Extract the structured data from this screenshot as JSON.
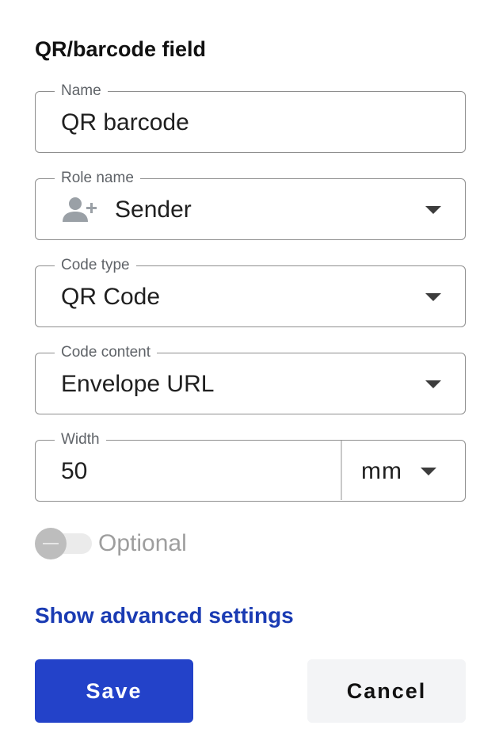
{
  "panel": {
    "title": "QR/barcode field"
  },
  "fields": {
    "name": {
      "label": "Name",
      "value": "QR barcode"
    },
    "role": {
      "label": "Role name",
      "value": "Sender",
      "icon": "add-person-icon"
    },
    "code_type": {
      "label": "Code type",
      "value": "QR Code"
    },
    "code_content": {
      "label": "Code content",
      "value": "Envelope URL"
    },
    "width": {
      "label": "Width",
      "value": "50",
      "unit": "mm"
    }
  },
  "optional_toggle": {
    "label": "Optional",
    "on": false
  },
  "advanced_link": "Show advanced settings",
  "buttons": {
    "save": "Save",
    "cancel": "Cancel"
  },
  "colors": {
    "primary": "#2342c9",
    "link": "#1a3bb3",
    "border": "#8e8e8e",
    "muted_text": "#5f6368",
    "disabled_text": "#9e9e9e"
  }
}
